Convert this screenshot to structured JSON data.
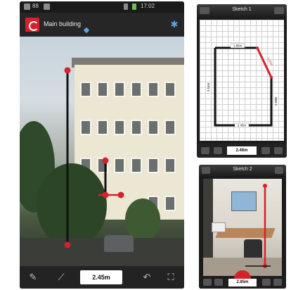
{
  "phone_main": {
    "status": {
      "carrier": "88",
      "time": "17:02"
    },
    "app_title": "Main building",
    "measurement_value": "2.45m",
    "colors": {
      "accent": "#d6212b",
      "measure_line": "#111111",
      "bluetooth": "#5aa7e6"
    },
    "toolbar": {
      "icons": [
        "pen-icon",
        "ruler-icon",
        "undo-icon",
        "crop-icon"
      ]
    }
  },
  "phone_sketch": {
    "title": "Sketch 1",
    "labels": {
      "top": "1.85m",
      "bottom": "2.46m",
      "left": "3.14m",
      "right": "1.60m",
      "diagonal": "1.20m"
    },
    "measurement_value": "2.46m"
  },
  "phone_photo": {
    "title": "Sketch 2",
    "measurement_value": "2.85m"
  }
}
